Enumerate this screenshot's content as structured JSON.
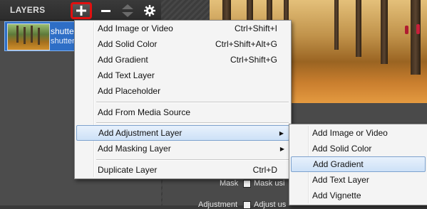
{
  "layers_panel": {
    "title": "LAYERS",
    "layer": {
      "name_line1": "shutte",
      "name_line2": "shutter"
    }
  },
  "properties": {
    "mask_label": "Mask",
    "mask_checkbox_label": "Mask usi",
    "adjustment_label": "Adjustment",
    "adjustment_checkbox_label": "Adjust us"
  },
  "main_menu": {
    "items": [
      {
        "label": "Add Image or Video",
        "shortcut": "Ctrl+Shift+I"
      },
      {
        "label": "Add Solid Color",
        "shortcut": "Ctrl+Shift+Alt+G"
      },
      {
        "label": "Add Gradient",
        "shortcut": "Ctrl+Shift+G"
      },
      {
        "label": "Add Text Layer",
        "shortcut": ""
      },
      {
        "label": "Add Placeholder",
        "shortcut": ""
      },
      {
        "label": "Add From Media Source",
        "shortcut": ""
      },
      {
        "label": "Add Adjustment Layer",
        "shortcut": ""
      },
      {
        "label": "Add Masking Layer",
        "shortcut": ""
      },
      {
        "label": "Duplicate Layer",
        "shortcut": "Ctrl+D"
      }
    ],
    "submenu_arrow": "▶"
  },
  "sub_menu": {
    "items": [
      {
        "label": "Add Image or Video"
      },
      {
        "label": "Add Solid Color"
      },
      {
        "label": "Add Gradient"
      },
      {
        "label": "Add Text Layer"
      },
      {
        "label": "Add Vignette"
      }
    ]
  },
  "icons": {
    "add": "plus-icon",
    "delete": "minus-icon",
    "move": "up-down-arrows-icon",
    "settings": "gear-icon"
  },
  "colors": {
    "highlight_ring": "#e01010",
    "selected_layer": "#2e6ec6",
    "menu_hover": "#cde1f7"
  }
}
